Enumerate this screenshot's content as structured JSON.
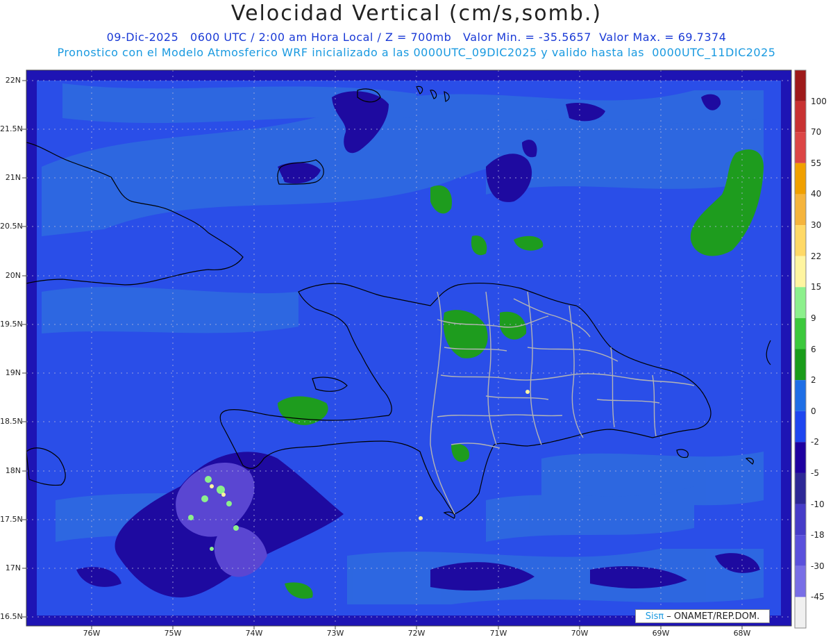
{
  "title": "Velocidad Vertical (cm/s,somb.)",
  "subtitle1": "09-Dic-2025   0600 UTC / 2:00 am Hora Local / Z = 700mb   Valor Min. = -35.5657  Valor Max. = 69.7374",
  "subtitle2": "Pronostico con el Modelo Atmosferico WRF inicializado a las 0000UTC_09DIC2025 y valido hasta las  0000UTC_11DIC2025",
  "lat_labels": [
    "22N",
    "21.5N",
    "21N",
    "20.5N",
    "20N",
    "19.5N",
    "19N",
    "18.5N",
    "18N",
    "17.5N",
    "17N",
    "16.5N"
  ],
  "lon_labels": [
    "76W",
    "75W",
    "74W",
    "73W",
    "72W",
    "71W",
    "70W",
    "69W",
    "68W"
  ],
  "colorbar": {
    "labels": [
      "100",
      "70",
      "55",
      "40",
      "30",
      "22",
      "15",
      "9",
      "6",
      "2",
      "0",
      "-2",
      "-5",
      "-10",
      "-18",
      "-30",
      "-45"
    ],
    "colors": [
      "#9e1a1a",
      "#c83232",
      "#dc4646",
      "#f0a000",
      "#f5b43c",
      "#ffd966",
      "#fff5a0",
      "#8cf08c",
      "#3cc83c",
      "#1a9c1a",
      "#1e6ee6",
      "#1e46f0",
      "#1e00a0",
      "#2d2896",
      "#463cc8",
      "#5a50dc",
      "#786ee6",
      "#f0f0f0"
    ]
  },
  "credit": {
    "brand": "Sisπ",
    "text": "– ONAMET/REP.DOM."
  }
}
